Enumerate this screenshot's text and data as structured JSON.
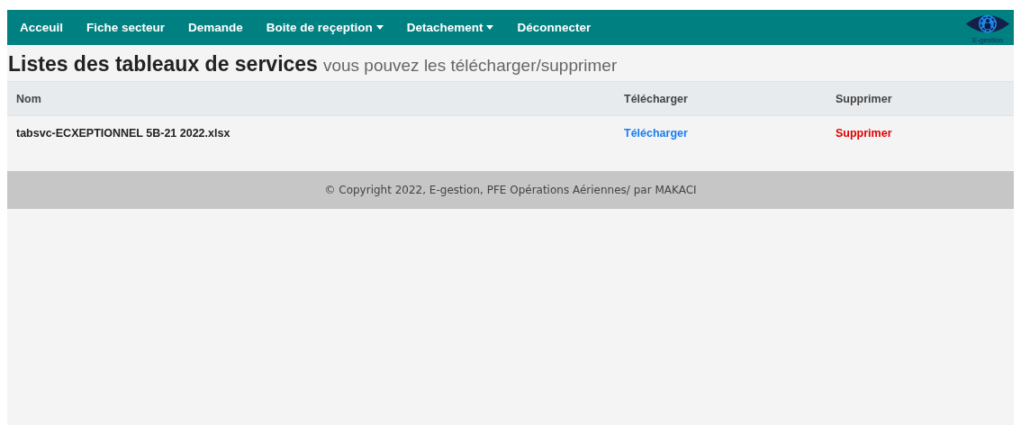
{
  "navbar": {
    "items": [
      {
        "label": "Acceuil",
        "dropdown": false
      },
      {
        "label": "Fiche secteur",
        "dropdown": false
      },
      {
        "label": "Demande",
        "dropdown": false
      },
      {
        "label": "Boite de reçeption",
        "dropdown": true
      },
      {
        "label": "Detachement",
        "dropdown": true
      },
      {
        "label": "Déconnecter",
        "dropdown": false
      }
    ],
    "logo_text": "E-gestion"
  },
  "heading": {
    "title": "Listes des tableaux de services",
    "subtitle": "vous pouvez les télécharger/supprimer"
  },
  "table": {
    "columns": [
      "Nom",
      "Télécharger",
      "Supprimer"
    ],
    "rows": [
      {
        "name": "tabsvc-ECXEPTIONNEL 5B-21 2022.xlsx",
        "download": "Télécharger",
        "delete": "Supprimer"
      }
    ]
  },
  "footer": "© Copyright 2022, E-gestion, PFE Opérations Aériennes/ par MAKACI"
}
